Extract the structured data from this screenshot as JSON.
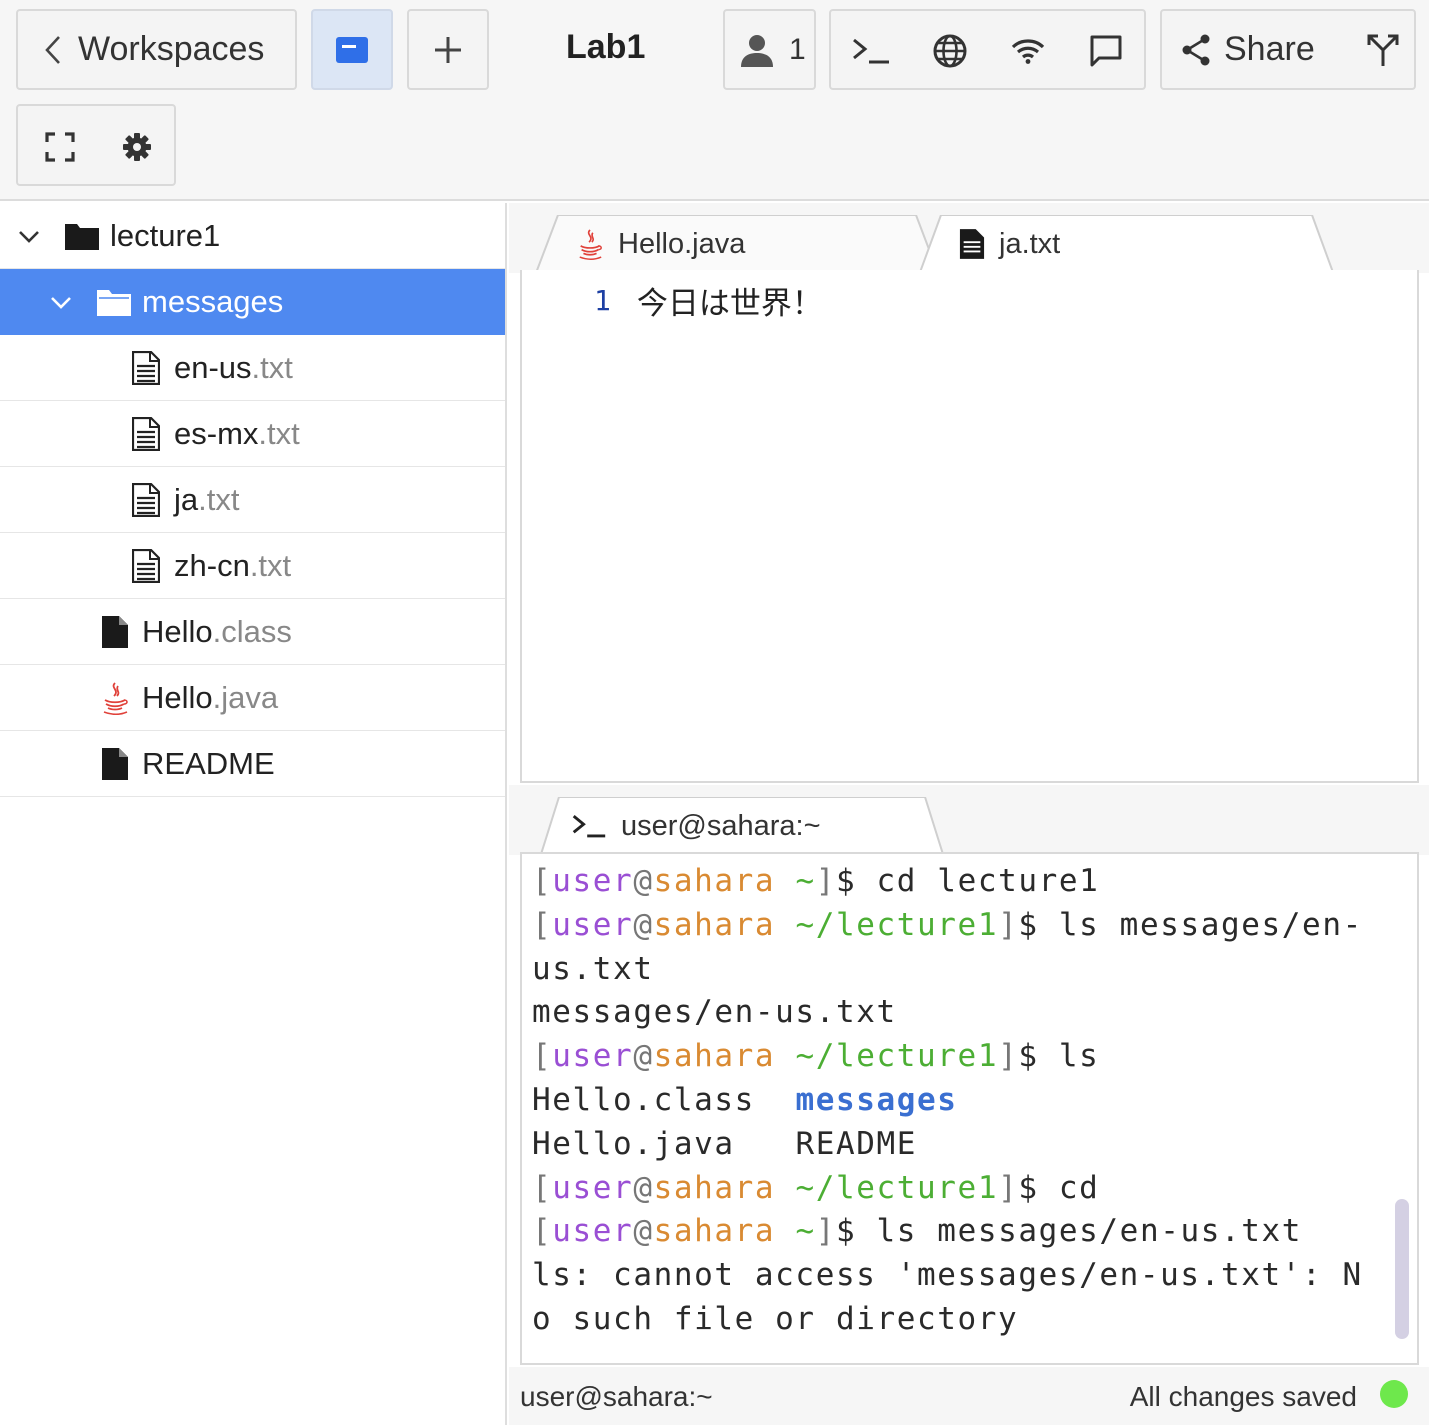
{
  "toolbar": {
    "workspaces_label": "Workspaces",
    "title": "Lab1",
    "user_count": "1",
    "share_label": "Share",
    "icons": [
      "chevron-left-icon",
      "files-icon",
      "plus-icon",
      "user-icon",
      "terminal-icon",
      "globe-icon",
      "wifi-icon",
      "chat-icon",
      "share-icon",
      "fork-icon",
      "fullscreen-icon",
      "gear-icon"
    ]
  },
  "tree": {
    "items": [
      {
        "name": "lecture1",
        "ext": "",
        "kind": "folder",
        "expanded": true
      },
      {
        "name": "messages",
        "ext": "",
        "kind": "folder",
        "expanded": true,
        "selected": true
      },
      {
        "name": "en-us",
        "ext": ".txt",
        "kind": "text-file"
      },
      {
        "name": "es-mx",
        "ext": ".txt",
        "kind": "text-file"
      },
      {
        "name": "ja",
        "ext": ".txt",
        "kind": "text-file"
      },
      {
        "name": "zh-cn",
        "ext": ".txt",
        "kind": "text-file"
      },
      {
        "name": "Hello",
        "ext": ".class",
        "kind": "file"
      },
      {
        "name": "Hello",
        "ext": ".java",
        "kind": "java-file"
      },
      {
        "name": "README",
        "ext": "",
        "kind": "file"
      }
    ]
  },
  "editor": {
    "tabs": [
      {
        "label": "Hello.java",
        "active": false
      },
      {
        "label": "ja.txt",
        "active": true
      }
    ],
    "line_number": "1",
    "line_text": "今日は世界！"
  },
  "terminal": {
    "tab_label": "user@sahara:~",
    "prompt_user": "user",
    "prompt_host": "sahara",
    "lines": [
      {
        "path": "~",
        "cmd": "cd lecture1"
      },
      {
        "path": "~/lecture1",
        "cmd": "ls messages/en-",
        "cont": "us.txt"
      },
      {
        "output": "messages/en-us.txt"
      },
      {
        "path": "~/lecture1",
        "cmd": "ls"
      },
      {
        "ls_row": [
          "Hello.class",
          "messages"
        ]
      },
      {
        "ls_row": [
          "Hello.java",
          "README"
        ]
      },
      {
        "path": "~/lecture1",
        "cmd": "cd"
      },
      {
        "path": "~",
        "cmd": "ls messages/en-us.txt"
      },
      {
        "output": "ls: cannot access 'messages/en-us.txt': N"
      },
      {
        "output": "o such file or directory"
      }
    ]
  },
  "status": {
    "left": "user@sahara:~",
    "right": "All changes saved",
    "dot_color": "#6ee84c"
  },
  "colors": {
    "selection": "#4f89f0",
    "prompt_user": "#9a4fd4",
    "prompt_host": "#d98a32",
    "prompt_path": "#4cae34",
    "dir": "#3a6fd1"
  }
}
